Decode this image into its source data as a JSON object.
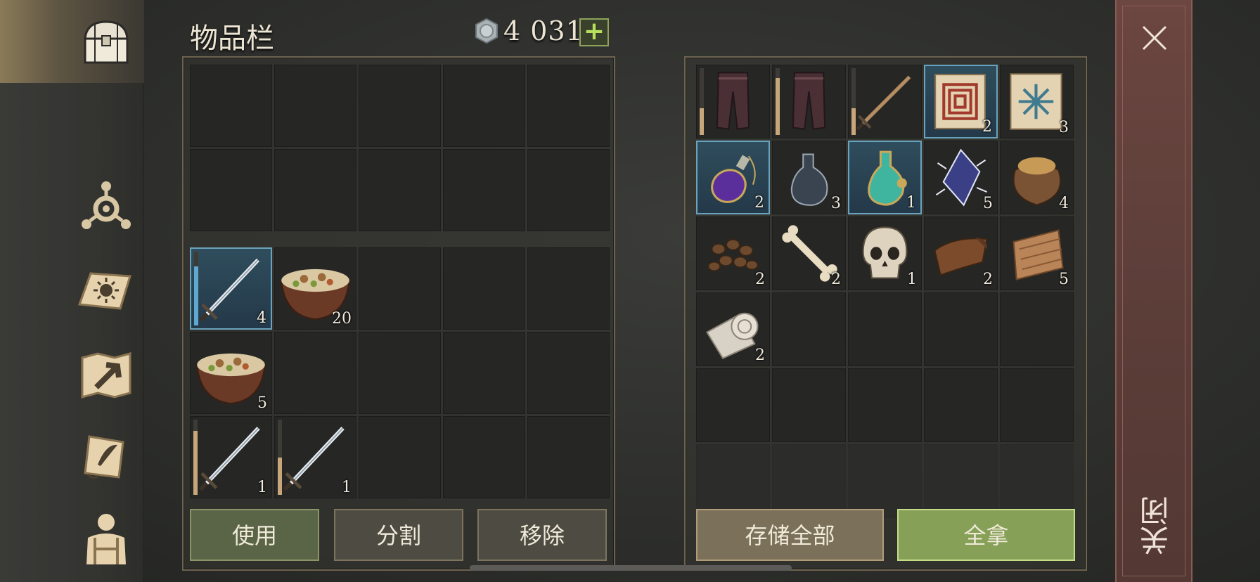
{
  "header": {
    "title": "物品栏",
    "coin_amount": "4 031",
    "add_label": "+"
  },
  "nav": [
    "chest-icon",
    "crafting-icon",
    "sun-book-icon",
    "map-icon",
    "quest-scroll-icon",
    "character-icon"
  ],
  "inventory": {
    "top_rows": 2,
    "slots": [
      {
        "icon": "sword",
        "qty": "4",
        "durability": 0.8,
        "highlight": true,
        "blue": true,
        "tool": true
      },
      {
        "icon": "stew",
        "qty": "20"
      },
      {},
      {},
      {},
      {
        "icon": "stew",
        "qty": "5"
      },
      {},
      {},
      {},
      {},
      {
        "icon": "sword",
        "qty": "1",
        "durability": 0.85,
        "tool": true
      },
      {
        "icon": "sword",
        "qty": "1",
        "durability": 0.5,
        "tool": true
      },
      {},
      {},
      {}
    ]
  },
  "storage": {
    "slots": [
      {
        "icon": "pants",
        "durability": 0.4
      },
      {
        "icon": "pants",
        "durability": 0.85
      },
      {
        "icon": "sword-plain",
        "durability": 0.4
      },
      {
        "icon": "scroll-red",
        "qty": "2",
        "highlight": true
      },
      {
        "icon": "scroll-blue",
        "qty": "3"
      },
      {
        "icon": "potion-purple",
        "qty": "2",
        "highlight": true
      },
      {
        "icon": "flask",
        "qty": "3"
      },
      {
        "icon": "potion-green",
        "qty": "1",
        "highlight": true
      },
      {
        "icon": "crystal",
        "qty": "5"
      },
      {
        "icon": "sack",
        "qty": "4"
      },
      {
        "icon": "beans",
        "qty": "2"
      },
      {
        "icon": "bone",
        "qty": "2"
      },
      {
        "icon": "skull",
        "qty": "1"
      },
      {
        "icon": "leather",
        "qty": "2"
      },
      {
        "icon": "cloth",
        "qty": "5"
      },
      {
        "icon": "bandage",
        "qty": "2"
      },
      {},
      {},
      {},
      {},
      {},
      {},
      {},
      {},
      {},
      {},
      {},
      {},
      {},
      {}
    ]
  },
  "buttons": {
    "use": "使用",
    "split": "分割",
    "remove": "移除",
    "store_all": "存储全部",
    "take_all": "全拿"
  },
  "close": {
    "label": "关闭"
  },
  "colors": {
    "accent_green": "#86a058",
    "highlight_blue": "#6aa3bd",
    "close_red": "#6c4640"
  }
}
